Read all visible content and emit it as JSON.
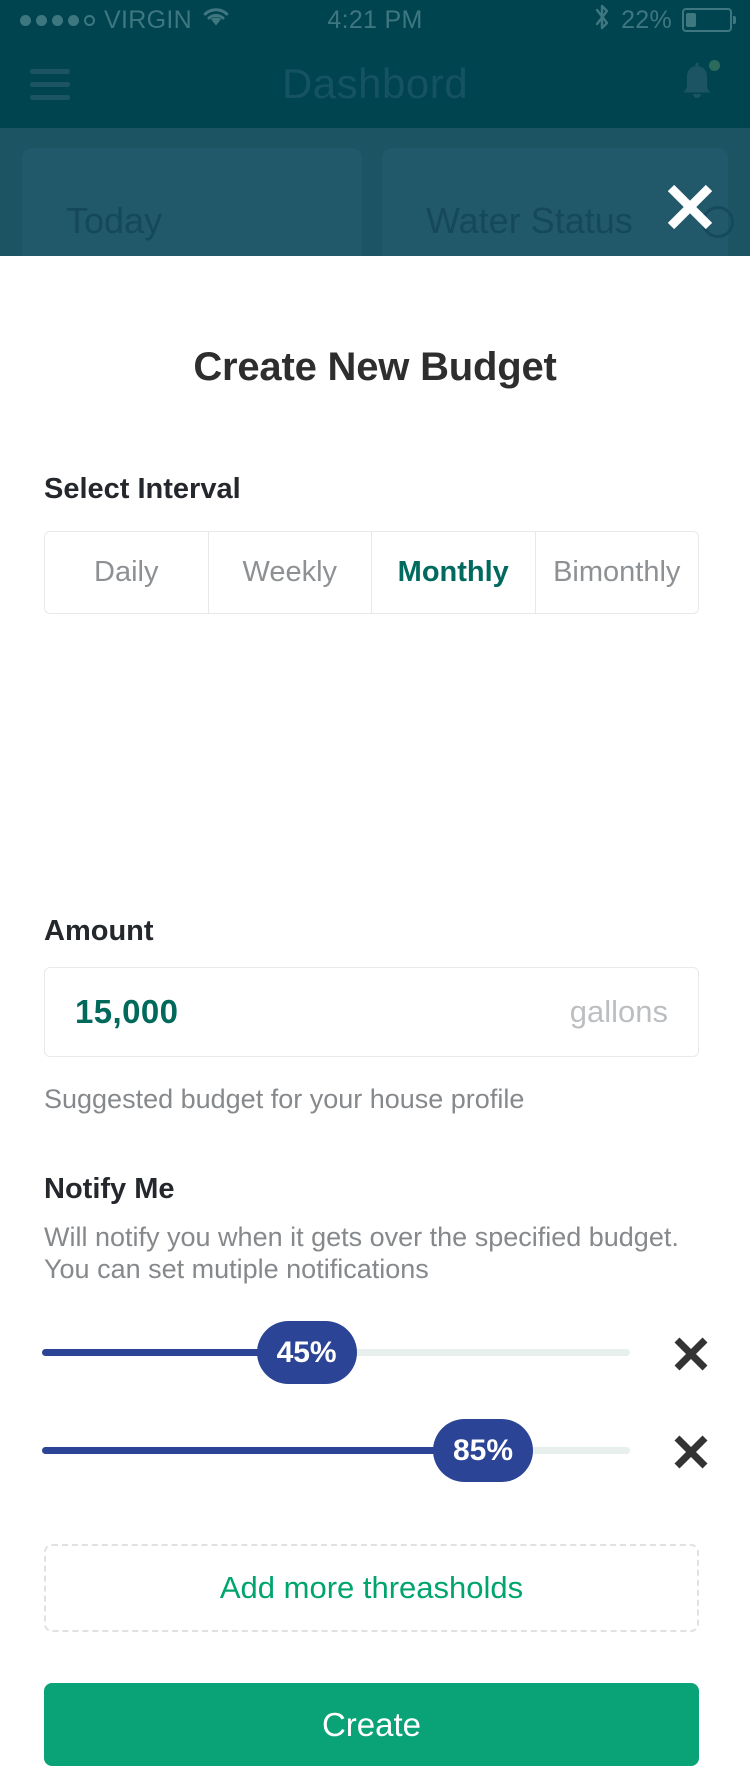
{
  "status_bar": {
    "carrier": "VIRGIN",
    "signal_dots_filled": 4,
    "signal_dots_total": 5,
    "wifi_icon": "wifi-icon",
    "time": "4:21 PM",
    "bluetooth_icon": "bluetooth-icon",
    "battery_percent": "22%",
    "battery_icon": "battery-icon"
  },
  "navbar": {
    "menu_icon": "hamburger-menu-icon",
    "title": "Dashbord",
    "bell_icon": "bell-icon",
    "has_notification_dot": true
  },
  "background_cards": [
    {
      "title": "Today"
    },
    {
      "title": "Water Status",
      "info_icon": "info-circle-icon"
    }
  ],
  "close_icon": "close-x-icon",
  "modal": {
    "title": "Create New Budget",
    "interval": {
      "label": "Select Interval",
      "options": [
        {
          "label": "Daily",
          "selected": false
        },
        {
          "label": "Weekly",
          "selected": false
        },
        {
          "label": "Monthly",
          "selected": true
        },
        {
          "label": "Bimonthly",
          "selected": false
        }
      ],
      "selected_value": "Monthly"
    },
    "amount": {
      "label": "Amount",
      "value": "15,000",
      "placeholder": "15,000",
      "unit": "gallons",
      "hint": "Suggested budget for your house profile"
    },
    "notify": {
      "label": "Notify Me",
      "description": "Will notify you when it gets over the specified budget. You can set mutiple notifications",
      "thresholds": [
        {
          "value": 45,
          "label": "45%",
          "delete_icon": "close-x-icon"
        },
        {
          "value": 85,
          "label": "85%",
          "delete_icon": "close-x-icon"
        }
      ],
      "add_label": "Add more threasholds"
    },
    "submit_label": "Create"
  },
  "colors": {
    "navbar": "#004450",
    "backdrop": "#1d5463",
    "accent_teal": "#006a5e",
    "accent_green": "#0aa277",
    "slider_blue": "#2b4496",
    "muted_text": "#86898c"
  }
}
